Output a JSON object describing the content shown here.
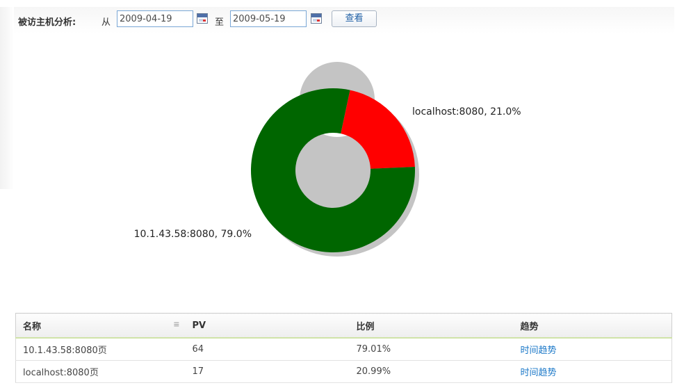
{
  "toolbar": {
    "title": "被访主机分析:",
    "from_label": "从",
    "from_date": "2009-04-19",
    "to_label": "至",
    "to_date": "2009-05-19",
    "view_button": "查看"
  },
  "chart_data": {
    "type": "pie",
    "style": "donut",
    "slices": [
      {
        "label": "localhost:8080, 21.0%",
        "name": "localhost:8080",
        "value": 21.0,
        "color": "#ff0000"
      },
      {
        "label": "10.1.43.58:8080, 79.0%",
        "name": "10.1.43.58:8080",
        "value": 79.0,
        "color": "#006600"
      }
    ]
  },
  "table": {
    "columns": [
      "名称",
      "PV",
      "比例",
      "趋势"
    ],
    "rows": [
      {
        "name": "10.1.43.58:8080页",
        "pv": "64",
        "ratio": "79.01%",
        "trend": "时间趋势"
      },
      {
        "name": "localhost:8080页",
        "pv": "17",
        "ratio": "20.99%",
        "trend": "时间趋势"
      }
    ]
  }
}
